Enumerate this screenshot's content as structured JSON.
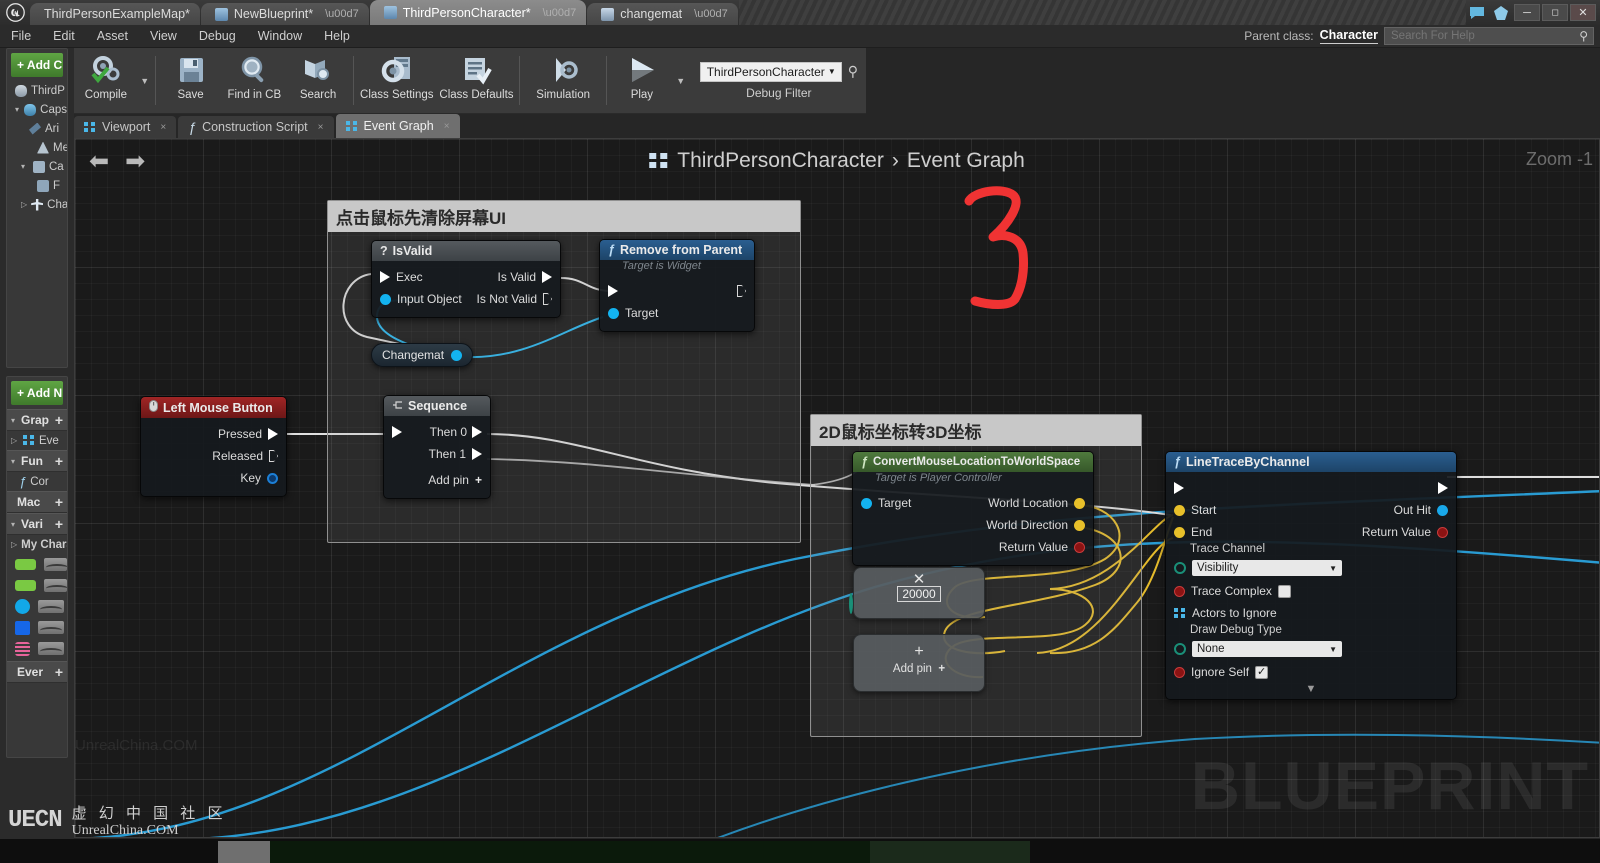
{
  "window": {
    "logo": "ue-logo",
    "tabs": [
      {
        "label": "ThirdPersonExampleMap*",
        "icon": "map-icon",
        "active": false,
        "closable": false
      },
      {
        "label": "NewBlueprint*",
        "icon": "blueprint-icon",
        "active": false,
        "closable": true
      },
      {
        "label": "ThirdPersonCharacter*",
        "icon": "blueprint-icon",
        "active": true,
        "closable": true
      },
      {
        "label": "changemat",
        "icon": "material-icon",
        "active": false,
        "closable": true
      }
    ],
    "controls": {
      "minimize": "─",
      "maximize": "❐",
      "close": "✕"
    },
    "notify_icons": [
      "chat-bubble-icon",
      "source-control-icon"
    ]
  },
  "menubar": {
    "items": [
      "File",
      "Edit",
      "Asset",
      "View",
      "Debug",
      "Window",
      "Help"
    ],
    "parent_class_label": "Parent class:",
    "parent_class_value": "Character",
    "search_placeholder": "Search For Help"
  },
  "toolbar": {
    "buttons": [
      {
        "label": "Compile",
        "icon": "compile-icon",
        "has_caret": true
      },
      {
        "label": "Save",
        "icon": "save-icon",
        "has_caret": false
      },
      {
        "label": "Find in CB",
        "icon": "magnifier-icon",
        "has_caret": false
      },
      {
        "label": "Search",
        "icon": "search-icon",
        "has_caret": false
      },
      {
        "label": "Class Settings",
        "icon": "gear-icon",
        "has_caret": false
      },
      {
        "label": "Class Defaults",
        "icon": "checklist-icon",
        "has_caret": false
      },
      {
        "label": "Simulation",
        "icon": "simulation-icon",
        "has_caret": false
      },
      {
        "label": "Play",
        "icon": "play-icon",
        "has_caret": true
      }
    ],
    "debug": {
      "selected": "ThirdPersonCharacter",
      "caption": "Debug Filter",
      "search_icon": "magnifier-icon"
    }
  },
  "subtabs": [
    {
      "label": "Viewport",
      "icon": "viewport-icon",
      "active": false
    },
    {
      "label": "Construction Script",
      "icon": "function-icon",
      "active": false
    },
    {
      "label": "Event Graph",
      "icon": "graph-icon",
      "active": true
    }
  ],
  "components_panel": {
    "add_button": "+ Add C",
    "items": [
      {
        "label": "ThirdP",
        "icon": "capsule-icon",
        "indent": 0,
        "arrow": ""
      },
      {
        "label": "Caps",
        "icon": "capsule-icon",
        "indent": 0,
        "arrow": "▼"
      },
      {
        "label": "Ari",
        "icon": "arrow-icon",
        "indent": 1,
        "arrow": ""
      },
      {
        "label": "Me",
        "icon": "mesh-icon",
        "indent": 2,
        "arrow": ""
      },
      {
        "label": "Ca",
        "icon": "camera-boom-icon",
        "indent": 1,
        "arrow": "▼"
      },
      {
        "label": "F",
        "icon": "camera-icon",
        "indent": 2,
        "arrow": ""
      },
      {
        "label": "Char",
        "icon": "character-icon",
        "indent": 1,
        "arrow": "▷"
      }
    ]
  },
  "myblueprint_panel": {
    "add_button": "+ Add N",
    "sections": [
      {
        "label": "Grap",
        "plus": "+",
        "arrow": "▼"
      },
      {
        "label": "Fun",
        "plus": "+",
        "arrow": "▼"
      },
      {
        "label": "Mac",
        "plus": "+",
        "arrow": ""
      },
      {
        "label": "Vari",
        "plus": "+",
        "arrow": "▼"
      },
      {
        "label": "Ever",
        "plus": "+",
        "arrow": ""
      }
    ],
    "entries": [
      {
        "label": "Eve",
        "icon": "graph-icon",
        "arrow": "▷"
      },
      {
        "label": "Cor",
        "icon": "function-icon",
        "arrow": ""
      },
      {
        "label": "My Chara",
        "icon": "category-icon",
        "arrow": "▷"
      }
    ],
    "variables": [
      {
        "color": "#7ac943"
      },
      {
        "color": "#7ac943"
      },
      {
        "color": "#12a8e8"
      },
      {
        "color": "#1667e8"
      },
      {
        "color": "#e8649b"
      }
    ]
  },
  "graph": {
    "nav_back_icon": "arrow-left-icon",
    "nav_forward_icon": "arrow-right-icon",
    "breadcrumb_icon": "graph-icon",
    "breadcrumb_root": "ThirdPersonCharacter",
    "breadcrumb_sep": "›",
    "breadcrumb_leaf": "Event Graph",
    "zoom_label": "Zoom -1",
    "watermark": "BLUEPRINT",
    "watermark_site": "UnrealChina.COM",
    "annotation": "3"
  },
  "comments": [
    {
      "title": "点击鼠标先清除屏幕UI"
    },
    {
      "title": "2D鼠标坐标转3D坐标"
    }
  ],
  "nodes": {
    "isvalid": {
      "title": "IsValid",
      "icon": "question-mark-icon",
      "in_exec": "Exec",
      "in_object": "Input Object",
      "out_valid": "Is Valid",
      "out_not_valid": "Is Not Valid"
    },
    "remove_from_parent": {
      "title": "Remove from Parent",
      "icon": "function-icon",
      "subtitle": "Target is Widget",
      "target": "Target"
    },
    "changemat_var": {
      "label": "Changemat"
    },
    "left_mouse_button": {
      "title": "Left Mouse Button",
      "icon": "mouse-icon",
      "pressed": "Pressed",
      "released": "Released",
      "key": "Key"
    },
    "sequence": {
      "title": "Sequence",
      "icon": "sequence-icon",
      "then0": "Then 0",
      "then1": "Then 1",
      "add_pin": "Add pin"
    },
    "convert_mouse": {
      "title": "ConvertMouseLocationToWorldSpace",
      "icon": "function-icon",
      "subtitle": "Target is Player Controller",
      "target": "Target",
      "world_location": "World Location",
      "world_direction": "World Direction",
      "return_value": "Return Value"
    },
    "multiply": {
      "symbol": "✕",
      "value": "20000"
    },
    "add": {
      "symbol": "+",
      "add_pin": "Add pin"
    },
    "line_trace": {
      "title": "LineTraceByChannel",
      "icon": "function-icon",
      "start": "Start",
      "end": "End",
      "trace_channel_label": "Trace Channel",
      "trace_channel_value": "Visibility",
      "trace_complex": "Trace Complex",
      "actors_to_ignore": "Actors to Ignore",
      "draw_debug_label": "Draw Debug Type",
      "draw_debug_value": "None",
      "ignore_self": "Ignore Self",
      "ignore_self_checked": "✓",
      "out_hit": "Out Hit",
      "return_value": "Return Value",
      "collapse_icon": "chevron-down-icon"
    }
  },
  "footer": {
    "logo": "UECN",
    "line1": "虚 幻 中 国 社 区",
    "line2": "UnrealChina.COM"
  },
  "colors": {
    "accent_green": "#4f8c36",
    "exec_white": "#ffffff",
    "data_blue": "#13b3f0",
    "data_yellow": "#e8c02a",
    "data_red": "#8c1313",
    "annotation_red": "#f03333",
    "wire_cyan": "#29a8e0"
  }
}
